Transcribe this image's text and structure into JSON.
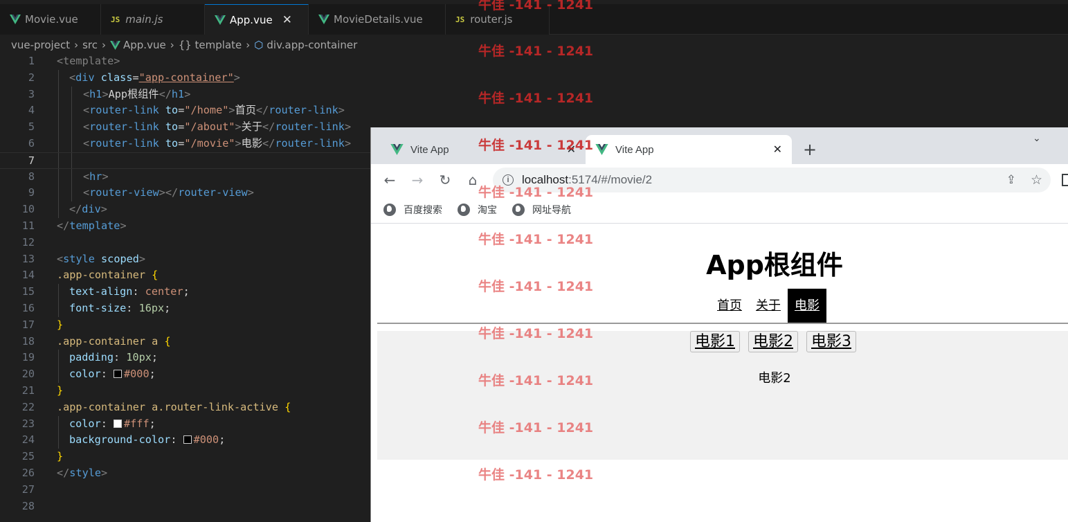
{
  "editor": {
    "tabs": [
      {
        "label": "Movie.vue",
        "icon": "vue-icon",
        "active": false
      },
      {
        "label": "main.js",
        "icon": "js-icon",
        "active": false
      },
      {
        "label": "App.vue",
        "icon": "vue-icon",
        "active": true,
        "close": "✕"
      },
      {
        "label": "MovieDetails.vue",
        "icon": "vue-icon",
        "active": false
      },
      {
        "label": "router.js",
        "icon": "js-icon",
        "active": false
      }
    ],
    "js_badge": "JS",
    "breadcrumb": [
      "vue-project",
      "src",
      "App.vue",
      "{} template",
      "div.app-container"
    ],
    "line_numbers": [
      "1",
      "2",
      "3",
      "4",
      "5",
      "6",
      "7",
      "8",
      "9",
      "10",
      "11",
      "12",
      "13",
      "14",
      "15",
      "16",
      "17",
      "18",
      "19",
      "20",
      "21",
      "22",
      "23",
      "24",
      "25",
      "26",
      "27",
      "28"
    ],
    "code": {
      "l1": "<template>",
      "l2_open": "<div",
      "l2_attr": "class",
      "l2_val": "\"app-container\"",
      "l3_text": "App根组件",
      "l4_to": "\"/home\"",
      "l4_text": "首页",
      "l5_to": "\"/about\"",
      "l5_text": "关于",
      "l6_to": "\"/movie\"",
      "l6_text": "电影",
      "tag_h1": "h1",
      "tag_router_link": "router-link",
      "tag_hr": "hr",
      "tag_router_view": "router-view",
      "tag_div": "div",
      "tag_template": "template",
      "tag_style": "style",
      "attr_to": "to",
      "attr_scoped": "scoped",
      "sel_container": ".app-container",
      "sel_container_a": ".app-container a",
      "sel_container_active": ".app-container a.router-link-active",
      "prop_text_align": "text-align",
      "val_center": "center",
      "prop_font_size": "font-size",
      "val_16px": "16px",
      "prop_padding": "padding",
      "val_10px": "10px",
      "prop_color": "color",
      "val_000": "#000",
      "val_fff": "#fff",
      "prop_bg": "background-color"
    }
  },
  "browser": {
    "tabs": [
      {
        "title": "Vite App",
        "active": false
      },
      {
        "title": "Vite App",
        "active": true
      }
    ],
    "url_host": "localhost",
    "url_path": ":5174/#/movie/2",
    "bookmarks": [
      "百度搜索",
      "淘宝",
      "网址导航"
    ],
    "page": {
      "title": "App根组件",
      "nav": [
        "首页",
        "关于",
        "电影"
      ],
      "active_nav": "电影",
      "movie_links": [
        "电影1",
        "电影2",
        "电影3"
      ],
      "movie_detail": "电影2"
    }
  },
  "watermark": "牛佳 -141 - 1241",
  "colors": {
    "editor_bg": "#1f1f1f",
    "accent": "#0078d4",
    "vue_green": "#42b883",
    "watermark": "#c82828"
  }
}
